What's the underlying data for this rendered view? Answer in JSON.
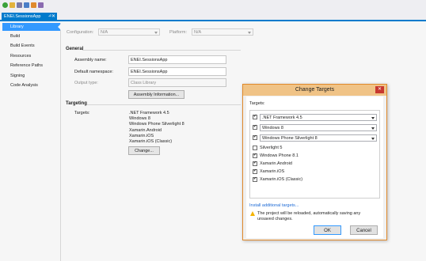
{
  "toolbar": {
    "icons": [
      {
        "name": "refresh-icon",
        "color": "#3aa13a"
      },
      {
        "name": "folder-icon",
        "color": "#e3b23c"
      },
      {
        "name": "save-icon",
        "color": "#7a7aa8"
      },
      {
        "name": "download-icon",
        "color": "#4a7ec7"
      },
      {
        "name": "upload-icon",
        "color": "#e08a2c"
      },
      {
        "name": "tools-icon",
        "color": "#8a6ab0"
      }
    ]
  },
  "tab": {
    "label": "ENEI.SessionsApp",
    "pin": "⊿",
    "close": "✕"
  },
  "nav": {
    "items": [
      {
        "label": "Library"
      },
      {
        "label": "Build"
      },
      {
        "label": "Build Events"
      },
      {
        "label": "Resources"
      },
      {
        "label": "Reference Paths"
      },
      {
        "label": "Signing"
      },
      {
        "label": "Code Analysis"
      }
    ]
  },
  "config": {
    "configuration_label": "Configuration:",
    "configuration_value": "N/A",
    "platform_label": "Platform:",
    "platform_value": "N/A"
  },
  "general": {
    "title": "General",
    "assembly_name_label": "Assembly name:",
    "assembly_name_value": "ENEI.SessionsApp",
    "default_namespace_label": "Default namespace:",
    "default_namespace_value": "ENEI.SessionsApp",
    "output_type_label": "Output type:",
    "output_type_value": "Class Library",
    "assembly_info_button": "Assembly Information..."
  },
  "targeting": {
    "title": "Targeting",
    "targets_label": "Targets:",
    "targets": [
      ".NET Framework 4.5",
      "Windows 8",
      "Windows Phone Silverlight 8",
      "Xamarin.Android",
      "Xamarin.iOS",
      "Xamarin.iOS (Classic)"
    ],
    "change_button": "Change..."
  },
  "dialog": {
    "title": "Change Targets",
    "close": "✕",
    "targets_label": "Targets:",
    "dropdowns": [
      {
        "label": ".NET Framework 4.5",
        "checked": true
      },
      {
        "label": "Windows 8",
        "checked": true
      },
      {
        "label": "Windows Phone Silverlight 8",
        "checked": true
      }
    ],
    "checkboxes": [
      {
        "label": "Silverlight 5",
        "checked": false
      },
      {
        "label": "Windows Phone 8.1",
        "checked": true
      },
      {
        "label": "Xamarin.Android",
        "checked": true
      },
      {
        "label": "Xamarin.iOS",
        "checked": true
      },
      {
        "label": "Xamarin.iOS (Classic)",
        "checked": true
      }
    ],
    "install_link": "Install additional targets...",
    "warning": "The project will be reloaded, automatically saving any unsaved changes.",
    "ok": "OK",
    "cancel": "Cancel"
  },
  "colors": {
    "accent": "#007acc",
    "selection": "#3399ff",
    "dialog_title": "#f0c386",
    "close_red": "#c7372f"
  }
}
